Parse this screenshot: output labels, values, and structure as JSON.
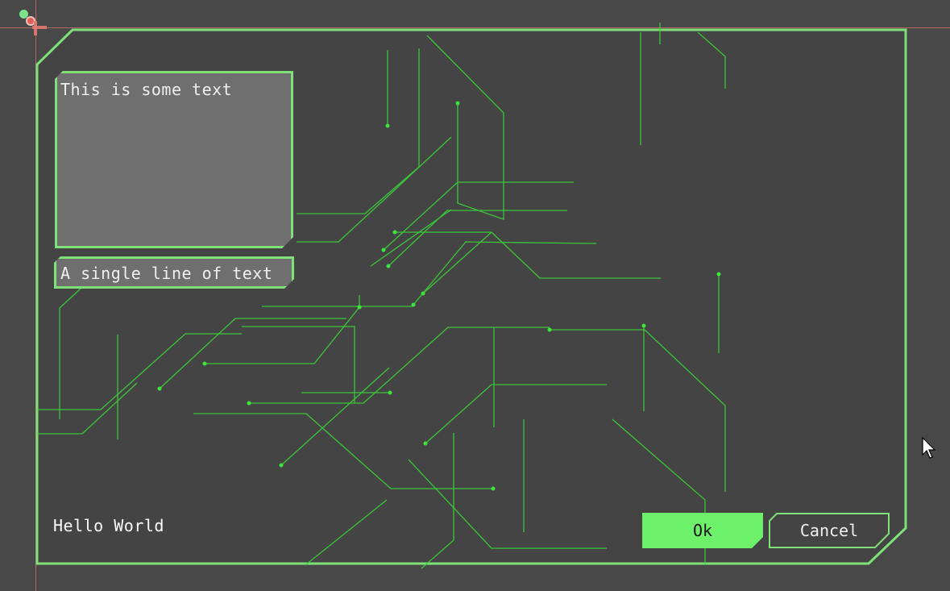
{
  "textbox": {
    "text": "This is some text"
  },
  "lineedit": {
    "value": "A single line of text"
  },
  "label": {
    "text": "Hello World"
  },
  "buttons": {
    "ok": "Ok",
    "cancel": "Cancel"
  },
  "colors": {
    "background": "#484848",
    "accent_green": "#6df06a",
    "border_green": "#7fe07a",
    "field_bg": "#6f6f6f",
    "guide_line": "#c9706a"
  }
}
